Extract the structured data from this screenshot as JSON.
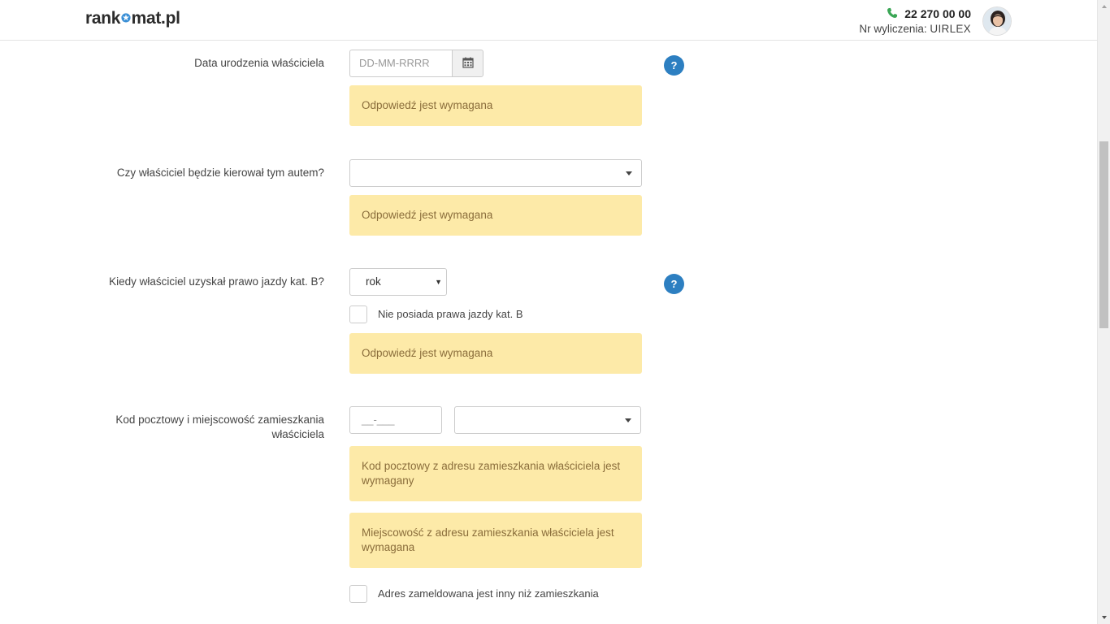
{
  "header": {
    "logo_text_a": "rank",
    "logo_text_b": "mat.pl",
    "phone": "22 270 00 00",
    "calc_label": "Nr wyliczenia:",
    "calc_code": "UIRLEX"
  },
  "form": {
    "birth": {
      "label": "Data urodzenia właściciela",
      "placeholder": "DD-MM-RRRR",
      "alert": "Odpowiedź jest wymagana",
      "help": "?"
    },
    "driver": {
      "label": "Czy właściciel będzie kierował tym autem?",
      "value": "",
      "alert": "Odpowiedź jest wymagana"
    },
    "license": {
      "label": "Kiedy właściciel uzyskał prawo jazdy kat. B?",
      "year_value": "rok",
      "no_license_label": "Nie posiada prawa jazdy kat. B",
      "alert": "Odpowiedź jest wymagana",
      "help": "?"
    },
    "address": {
      "label": "Kod pocztowy i miejscowość zamieszkania właściciela",
      "postal_value": "__-___",
      "city_value": "",
      "alert_postal": "Kod pocztowy z adresu zamieszkania właściciela jest wymagany",
      "alert_city": "Miejscowość z adresu zamieszkania właściciela jest wymagana",
      "different_address_label": "Adres zameldowana jest inny niż zamieszkania"
    }
  },
  "colors": {
    "accent": "#2d7fc1",
    "alert_bg": "#fdeaa8",
    "alert_text": "#8a6d3b",
    "phone_icon": "#3aa655"
  }
}
